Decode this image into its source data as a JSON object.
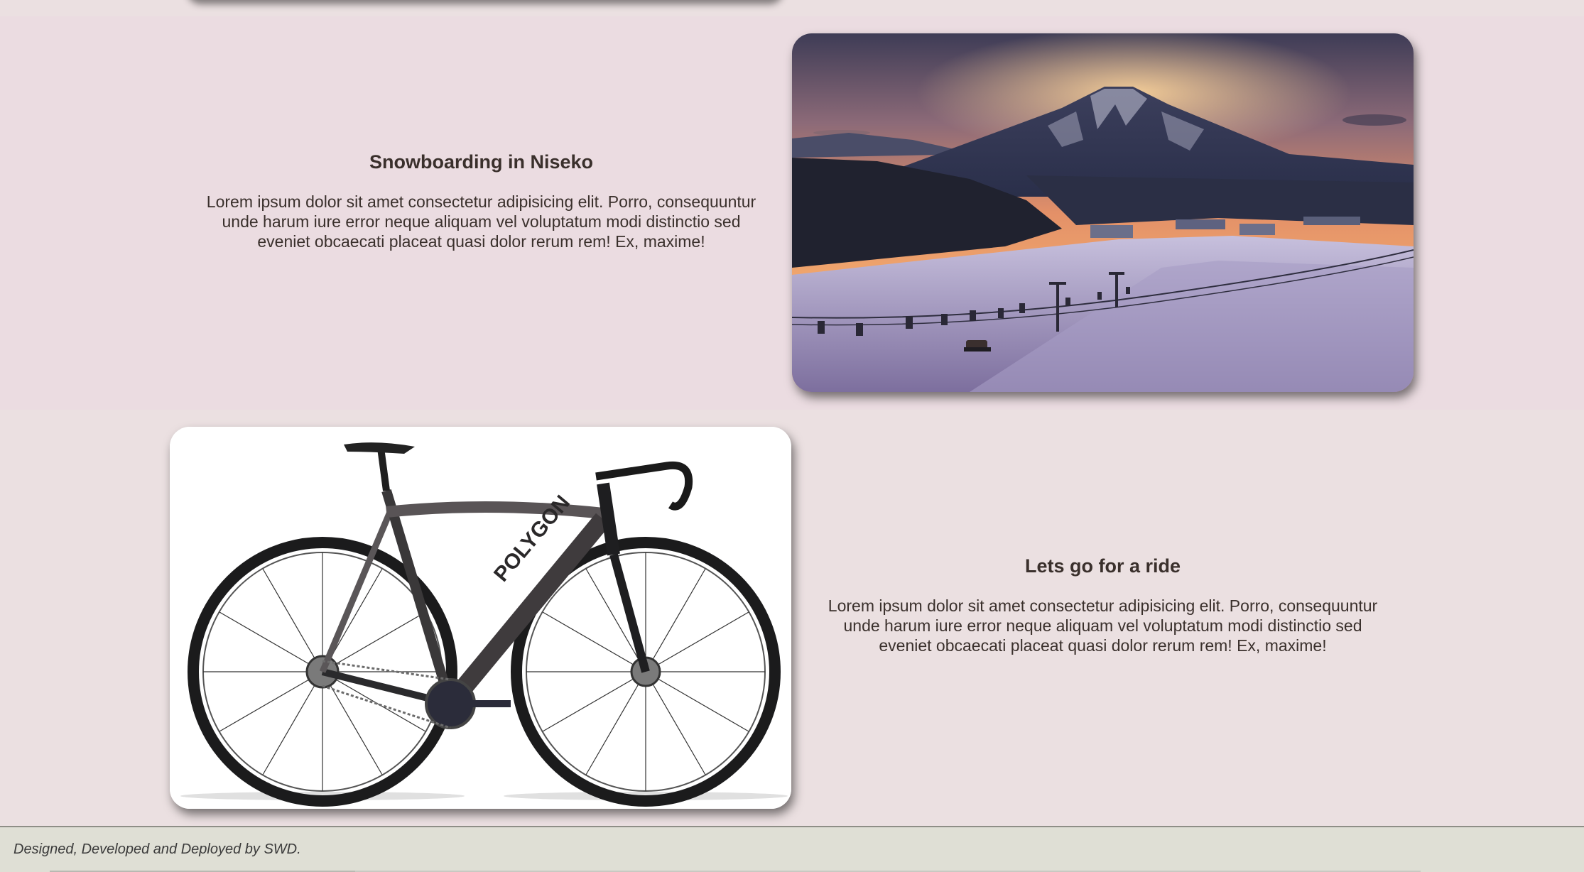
{
  "features": [
    {
      "title": "Snowboarding in Niseko",
      "description": "Lorem ipsum dolor sit amet consectetur adipisicing elit. Porro, consequuntur unde harum iure error neque aliquam vel voluptatum modi distinctio sed eveniet obcaecati placeat quasi dolor rerum rem! Ex, maxime!",
      "image": "mountain-ski-slope-photo"
    },
    {
      "title": "Lets go for a ride",
      "description": "Lorem ipsum dolor sit amet consectetur adipisicing elit. Porro, consequuntur unde harum iure error neque aliquam vel voluptatum modi distinctio sed eveniet obcaecati placeat quasi dolor rerum rem! Ex, maxime!",
      "image": "road-bike-photo",
      "image_brand_text": "POLYGON"
    }
  ],
  "footer": {
    "credit": "Designed, Developed and Deployed by SWD."
  },
  "colors": {
    "section_one_bg": "#ebdce1",
    "section_two_bg": "#ebe0e1",
    "footer_bg": "#dfdfd5",
    "text": "#3a302c"
  }
}
